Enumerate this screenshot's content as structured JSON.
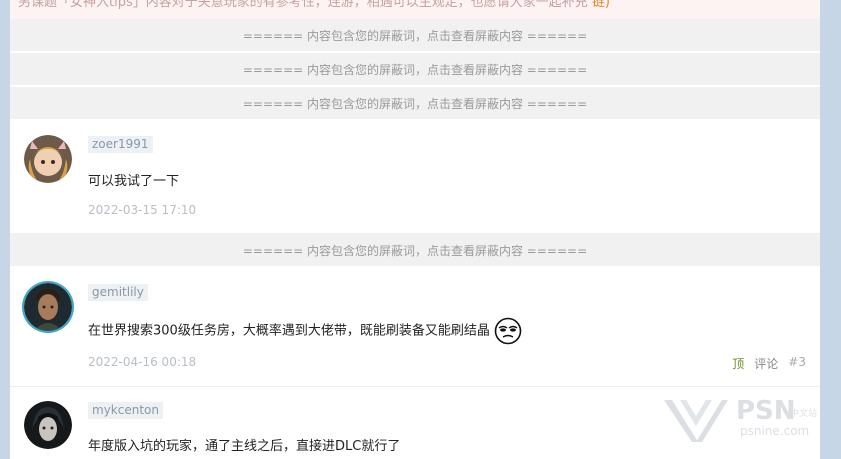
{
  "top_strip": {
    "prefix": "另课题「女神入tips」内容对于失意玩家的有参考性，连游，相遇可以主观定，也愿请大家一起补充",
    "suffix": "链)"
  },
  "blocked_text": "====== 内容包含您的屏蔽词，点击查看屏蔽内容 ======",
  "posts": [
    {
      "username": "zoer1991",
      "content": "可以我试了一下",
      "time": "2022-03-15 17:10"
    },
    {
      "username": "gemitlily",
      "content": "在世界搜索300级任务房，大概率遇到大佬带，既能刷装备又能刷结晶",
      "time": "2022-04-16 00:18",
      "action_top": "顶",
      "action_comment": "评论",
      "floor": "#3"
    },
    {
      "username": "mykcenton",
      "content": "年度版入坑的玩家，通了主线之后，直接进DLC就行了"
    }
  ],
  "watermark": {
    "brand": "PSN",
    "brand_cn": "中文站",
    "domain": "psnine.com"
  },
  "colors": {
    "blocked_bg": "#f1f1f1",
    "username_bg": "#eef1f4",
    "top_link": "#6b8e23"
  }
}
